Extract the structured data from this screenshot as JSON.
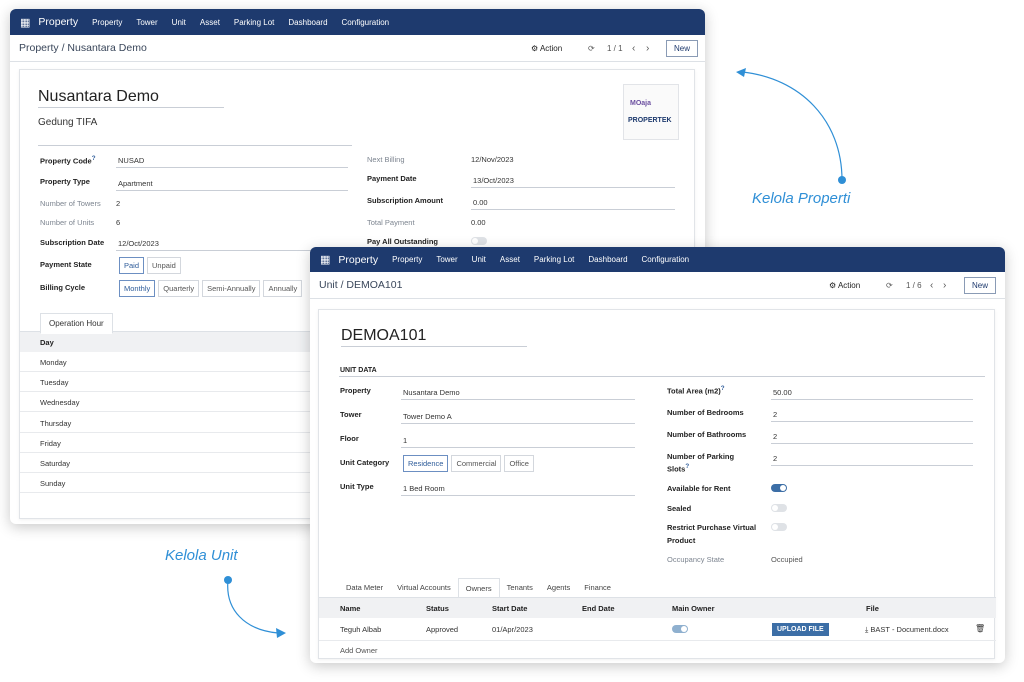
{
  "captions": {
    "properti": "Kelola Properti",
    "unit": "Kelola Unit"
  },
  "menu": {
    "app": "Property",
    "items": [
      "Property",
      "Tower",
      "Unit",
      "Asset",
      "Parking Lot",
      "Dashboard",
      "Configuration"
    ]
  },
  "w1": {
    "breadcrumb": "Property / Nusantara Demo",
    "action": "⚙ Action",
    "pager": "1 / 1",
    "new": "New",
    "name": "Nusantara Demo",
    "building": "Gedung TIFA",
    "logo_top": "MOaja",
    "logo_bottom": "PROPERTEK",
    "left": [
      {
        "l": "Property Code",
        "s": "?",
        "v": "NUSAD"
      },
      {
        "l": "Property Type",
        "v": "Apartment"
      },
      {
        "l": "Number of Towers",
        "v": "2"
      },
      {
        "l": "Number of Units",
        "v": "6"
      },
      {
        "l": "Subscription Date",
        "v": "12/Oct/2023"
      }
    ],
    "payment_state": {
      "label": "Payment State",
      "options": [
        "Paid",
        "Unpaid"
      ]
    },
    "billing": {
      "label": "Billing Cycle",
      "options": [
        "Monthly",
        "Quarterly",
        "Semi-Annually",
        "Annually"
      ]
    },
    "right": [
      {
        "l": "Next Billing",
        "v": "12/Nov/2023"
      },
      {
        "l": "Payment Date",
        "v": "13/Oct/2023"
      },
      {
        "l": "Subscription Amount",
        "v": "0.00"
      },
      {
        "l": "Total Payment",
        "v": "0.00"
      },
      {
        "l": "Pay All Outstanding"
      }
    ],
    "tab": "Operation Hour",
    "day_header": "Day",
    "days": [
      "Monday",
      "Tuesday",
      "Wednesday",
      "Thursday",
      "Friday",
      "Saturday",
      "Sunday"
    ]
  },
  "w2": {
    "breadcrumb": "Unit / DEMOA101",
    "action": "⚙ Action",
    "pager": "1 / 6",
    "new": "New",
    "name": "DEMOA101",
    "section": "UNIT DATA",
    "left": [
      {
        "l": "Property",
        "v": "Nusantara Demo"
      },
      {
        "l": "Tower",
        "v": "Tower Demo A"
      },
      {
        "l": "Floor",
        "v": "1"
      }
    ],
    "category": {
      "label": "Unit Category",
      "options": [
        "Residence",
        "Commercial",
        "Office"
      ]
    },
    "unit_type": {
      "l": "Unit Type",
      "v": "1 Bed Room"
    },
    "right": [
      {
        "l": "Total Area (m2)",
        "s": "?",
        "v": "50.00"
      },
      {
        "l": "Number of Bedrooms",
        "v": "2"
      },
      {
        "l": "Number of Bathrooms",
        "v": "2"
      },
      {
        "l": "Number of Parking",
        "l2": "Slots",
        "s": "?",
        "v": "2"
      }
    ],
    "toggles": [
      {
        "l": "Available for Rent",
        "on": true
      },
      {
        "l": "Sealed",
        "on": false
      },
      {
        "l": "Restrict Purchase Virtual",
        "l2": "Product",
        "on": false
      }
    ],
    "occupancy": {
      "l": "Occupancy State",
      "v": "Occupied"
    },
    "tabs": [
      "Data Meter",
      "Virtual Accounts",
      "Owners",
      "Tenants",
      "Agents",
      "Finance"
    ],
    "columns": [
      "Name",
      "Status",
      "Start Date",
      "End Date",
      "Main Owner",
      "File"
    ],
    "row": {
      "name": "Teguh Albab",
      "status": "Approved",
      "start": "01/Apr/2023",
      "end": "",
      "upload": "UPLOAD FILE",
      "file": "BAST - Document.docx"
    },
    "add": "Add Owner"
  }
}
